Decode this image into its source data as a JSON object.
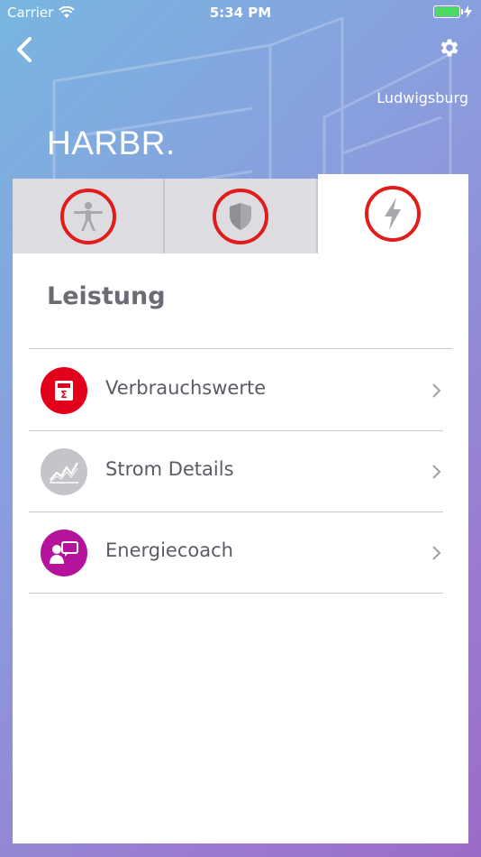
{
  "status_bar": {
    "carrier": "Carrier",
    "time": "5:34 PM"
  },
  "header": {
    "location": "Ludwigsburg",
    "brand": "HARBR."
  },
  "tabs": [
    {
      "icon": "vitruvian-man-icon",
      "active": false
    },
    {
      "icon": "shield-icon",
      "active": false
    },
    {
      "icon": "lightning-icon",
      "active": true
    }
  ],
  "section": {
    "title": "Leistung",
    "items": [
      {
        "label": "Verbrauchswerte",
        "icon": "calculator-icon",
        "color": "#e2001a"
      },
      {
        "label": "Strom Details",
        "icon": "chart-icon",
        "color": "#c4c4c9"
      },
      {
        "label": "Energiecoach",
        "icon": "coach-icon",
        "color": "#b5139b"
      }
    ]
  },
  "colors": {
    "accent_ring": "#e21b1b",
    "battery": "#4cd964"
  }
}
